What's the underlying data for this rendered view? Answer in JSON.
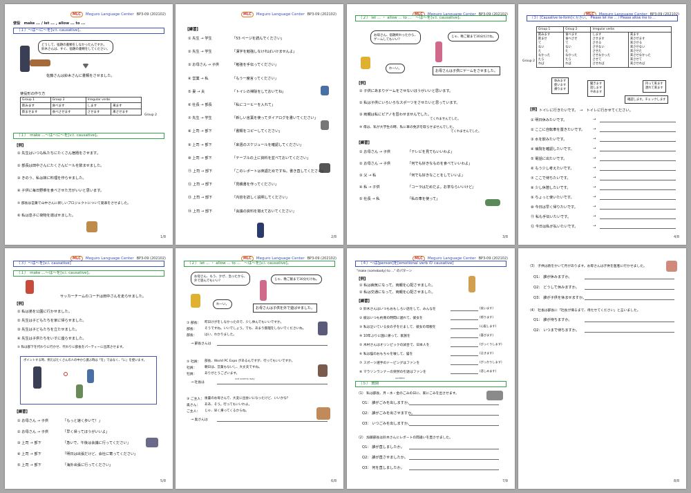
{
  "header": {
    "logo": "MLC",
    "school": "Meguro Language Center",
    "code": "BP3-09 (202102)"
  },
  "pages": {
    "p1": {
      "number": "1/8",
      "title": "使役　make ... / let ... , allow ... to ...",
      "section1": "（１）～は～に～を[v.t. causative]。",
      "bubble": "どうして、宿題の書類をしなかったんですか。\n鈴木さんは、すぐ、宿題の書類をしてください。",
      "caption": "佐藤さんは鈴木さんに書類をさせました。",
      "table_title": "使役形の作り方",
      "table_headers": [
        "Group 1",
        "Group 2",
        "Irregular verbs"
      ],
      "table_row1": [
        "飲みます",
        "食べます",
        "します",
        "来ます"
      ],
      "table_row2": [
        "飲ませます",
        "食べさせます",
        "させます",
        "来させます"
      ],
      "group2_label": "Group 2",
      "section2": "（１）　make ...～は～に～を[v.t. causative]。",
      "ex_label": "【例】",
      "items": [
        "① 先生はいつも私たちにたくさん宿題をさせます。",
        "② 部長は田中さんにたくさんビールを飲ませました。",
        "③ きのう、私は妹に料理を作らせました。",
        "④ 子供に毎日野菜を食べさせた方がいいと思います。",
        "⑤ 部長は営業で山中さんに新しいプロジェクトについて発表をさせました。",
        "⑥ 私は息子に荷物を運ばせました。"
      ]
    },
    "p2": {
      "number": "2/8",
      "ex_label": "【練習】",
      "items": [
        [
          "① 先生 → 学生",
          "「53 ページを読んでください」"
        ],
        [
          "② 先生 → 学生",
          "「漢字を勉強しなければいけませんよ」"
        ],
        [
          "③ お母さん → 子供",
          "「勉強を手伝ってください」"
        ],
        [
          "④ 営業 → 私",
          "「もう一度言ってください」"
        ],
        [
          "⑤ 妻 → 夫",
          "「トイレの掃除をしておいてね」"
        ],
        [
          "⑥ 社長 → 部長",
          "「私にコーヒーを入れて」"
        ],
        [
          "⑦ 先生 → 学生",
          "「新しい言葉を使ってダイアログを書いてください」"
        ],
        [
          "⑧ 上司 → 部下",
          "「書類をコピーしてください」"
        ],
        [
          "⑨ 上司 → 部下",
          "「来週のスケジュールを確認してください」"
        ],
        [
          "⑩ 上司 → 部下",
          "「テーブルの上に資料を並べておいてください」"
        ],
        [
          "⑪ 上司 → 部下",
          "「このレポートは英語だめですね。書き直してください」"
        ],
        [
          "⑫ 上司 → 部下",
          "「見積書を作ってください」"
        ],
        [
          "⑬ 上司 → 部下",
          "「内容を詳しく説明してください」"
        ],
        [
          "⑭ 上司 → 部下",
          "「会議の資料を揃えておいてください」"
        ]
      ]
    },
    "p3": {
      "number": "3/8",
      "section": "（２） let ... ・ allow ... to ...　～は～を[v.t. causative]。",
      "bubble1": "お母さん、宿題終わったから、\nゲームしてもいい？",
      "bubble2": "じゃ、晩ご飯まで30分だけね。",
      "bubble3": "わーい。",
      "caption": "お母さんは子供にゲームをさせました。",
      "ex_label": "【例】",
      "items": [
        "① 子供にあまりゲームをさせないほうがいいと思います。",
        "② 私は子供にいろいろなスポーツをさせたいと思っています。",
        "③ 両親は私にピアノを習わせませんでした。",
        "④ 母は、私が大学生の時、私に車の免許を取らせませんでした。"
      ],
      "item3_note": "てくれませんでした。",
      "item4_note": "てくれませんでした。",
      "practice_label": "【練習】",
      "practice": [
        [
          "① お母さん → 子供",
          "「テレビを見てもいいわよ」"
        ],
        [
          "② お母さん → 子供",
          "「何でも好きなものを食べていいわよ」"
        ],
        [
          "③ 父 → 私",
          "「何でも好きなことをしていいよ」"
        ],
        [
          "④ 私 → 子供",
          "「コーラはだめだよ。お茶ならいいけど」"
        ],
        [
          "⑤ 社長 → 私",
          "「私の車を使って」"
        ]
      ]
    },
    "p4": {
      "number": "4/8",
      "section": "（３）[Causative te-form]ください。　Please let me ... / Please allow me to ...",
      "headers": [
        "Group 1",
        "Group 2",
        "Irregular verbs"
      ],
      "col1": [
        "飲みます",
        "飲ませ",
        "て",
        "ない",
        "た",
        "なかった",
        "たら",
        "れば"
      ],
      "col2": [
        "食べます",
        "食べさせ",
        "て",
        "ない",
        "た",
        "なかった",
        "たら",
        "れば"
      ],
      "col3": [
        "します",
        "させます",
        "させる",
        "させない",
        "させた",
        "させなかった",
        "させて",
        "させれば"
      ],
      "col4": [
        "来ます",
        "来させます",
        "来させる",
        "来させない",
        "来させた",
        "来させなかった",
        "来させて",
        "来させれば"
      ],
      "group2_label": "Group 2",
      "box1": [
        "休みます",
        "使います",
        "帰ります"
      ],
      "box2": [
        "聞きます",
        "話します",
        "やめます"
      ],
      "box3": [
        "持って来ます",
        "連れて来ます"
      ],
      "box4": "確認します。チェックします",
      "ex_label": "【例】",
      "ex_line": "トイレに行きたいです。　→　トイレに行かせてください。",
      "items": [
        "① 明日休みたいです。",
        "② ここに自転車を置きたいです。",
        "③ 水を飲みたいです。",
        "④ 病院を確認したいです。",
        "⑤ 電話に出たいです。",
        "⑥ もう少し考えたいです。",
        "⑦ ここで待ちたいです。",
        "⑧ 少し休憩したいです。",
        "⑨ ちょっと使いたいです。",
        "⑩ 今日は早く帰りたいです。",
        "⑪ 私も手伝いたいです。",
        "⑫ 今日は私が払いたいです。"
      ],
      "arrow": "→"
    },
    "p5": {
      "number": "5/8",
      "section1": "（３）～は～を[v.i. causative]",
      "section2": "（１）　make ...～は～を[v.i. causative]。",
      "caption": "サッカーチームのコーチは田中さんを走らせました。",
      "ex_label": "【例】",
      "items": [
        "① 私は弟を公園に行かせました。",
        "② 先生は子どもたちを家に帰らせました。",
        "③ 先生は子どもたちを立たせました。",
        "④ 先生は子供たちをいすに座らせました。",
        "⑤ 私は部下を代わりに行かせ、代わりに部長をパーティーに出席させます。"
      ],
      "point": "ポイントする時、例えばたくさんの人の中から選ぶ時は「を」ではなく、「に」を使います。",
      "practice_label": "【練習】",
      "practice": [
        [
          "① お母さん → 子供",
          "「もっと速く歩いて！」"
        ],
        [
          "② お母さん → 子供",
          "「早く帰ってほうがいいよ」"
        ],
        [
          "③ 上司 → 部下",
          "「急いで、午後は会議に行ってください」"
        ],
        [
          "④ 上司 → 部下",
          "「明日は出張だけど、会社に寄ってください」"
        ],
        [
          "⑤ 上司 → 部下",
          "「海外出張に行ってください」"
        ]
      ]
    },
    "p6": {
      "number": "6/8",
      "section": "（２） let ... ・ allow ... to ...　～は～を[v.i. causative]。",
      "bubble1": "お母さん、もう、かぜ、治ったから、\n外で遊んでもいい？",
      "bubble2": "じゃ、晩ご飯まで30分だけね。",
      "bubble3": "わーい。",
      "caption": "お母さんは子供を外で遊ばせました。",
      "d1": [
        "① 部長：",
        "昨日けがをしなかったので、少し休んでもいいですか。",
        "部長：",
        "そうですね。いいでしょう。でも、あまり無理をしないでくださいね。",
        "部長：",
        "はい、わかりました。",
        "→ 部長さんは"
      ],
      "d2": [
        "② 社員：",
        "部長、World PC Expo があるんですが、行ってもいいですか。",
        "社員：",
        "朝日は、営業もないし、大丈夫ですね。",
        "社員：",
        "ありがとうございます。",
        "→ 社長は"
      ],
      "d2_note": "not seems way",
      "d3": [
        "③ ご主人：",
        "後輩のお母さんで、大変に出会いになったけど、いいかな？",
        "奥さん：",
        "ああ、そう。行ってもいいわよ。",
        "ご主人：",
        "じゃ、早く帰ってくるからね。",
        "→ 奥さんは"
      ]
    },
    "p7": {
      "number": "7/8",
      "section1": "（４）～は[person]を[emotional verb の causative]",
      "subtitle": "\"make (somebody) to ...\" のパターン",
      "ex_label": "【例】",
      "ex": [
        "① 私は病気になって、両親を心配させました。",
        "② 私は交通になって、両親を心配させました。"
      ],
      "practice_label": "【練習】",
      "items": [
        "① 鈴木さんはいつもおもしろい話をして、みんなを",
        "② 彼はいつも約束の時間に遅れて、彼女を",
        "③ 私は泣いている女の子をだまして、彼女の母親を",
        "④ 10年ぶりに国に帰って、家族を",
        "⑤ 木村さんはオリンピックの試合で、日本人を",
        "⑥ 私は猫のおもちゃを壊して、猫を",
        "⑦ スポーツ選手のドーピングはファンを",
        "⑧ マラソンランナーの突然の引退はファンを"
      ],
      "answers": [
        "(笑います)",
        "(怒ります)",
        "(心配します)",
        "(喜びます)",
        "(びっくりします)",
        "(泣きます)",
        "(がっかりします)",
        "(悲しみます)"
      ],
      "sudden": "sudden",
      "section2": "（５） 質問",
      "q1_intro": "（1） 私は部長、月・水・金のごみの日に、家にごみを出させます。",
      "q1": [
        "Q1： 誰がごみを出しますか。",
        "Q2： 誰がごみを出させますか。",
        "Q3： いつごみを出しますか。"
      ],
      "q2_intro": "（2） 加藤部長は鈴木さんにレポートの間違いを直させました。",
      "q2": [
        "Q1： 誰が直しましたか。",
        "Q2： 誰が直させましたか。",
        "Q3： 何を直しましたか。"
      ]
    },
    "p8": {
      "number": "8/8",
      "q3_intro": "（3） 子供は熱をかいて月があります。お母さんは子供を医者に行かせました。",
      "q3": [
        "Q1： 誰が休みますか。",
        "Q2： どうして休みますか。",
        "Q3： 誰が子供を休ませますか。"
      ],
      "q4_intro": "（4） 社長は部長に「社長が帰るまで、待たせてください」と言いました。",
      "q4": [
        "Q1： 誰が待ちますか。",
        "Q2： いつまで待ちますか。"
      ]
    }
  }
}
